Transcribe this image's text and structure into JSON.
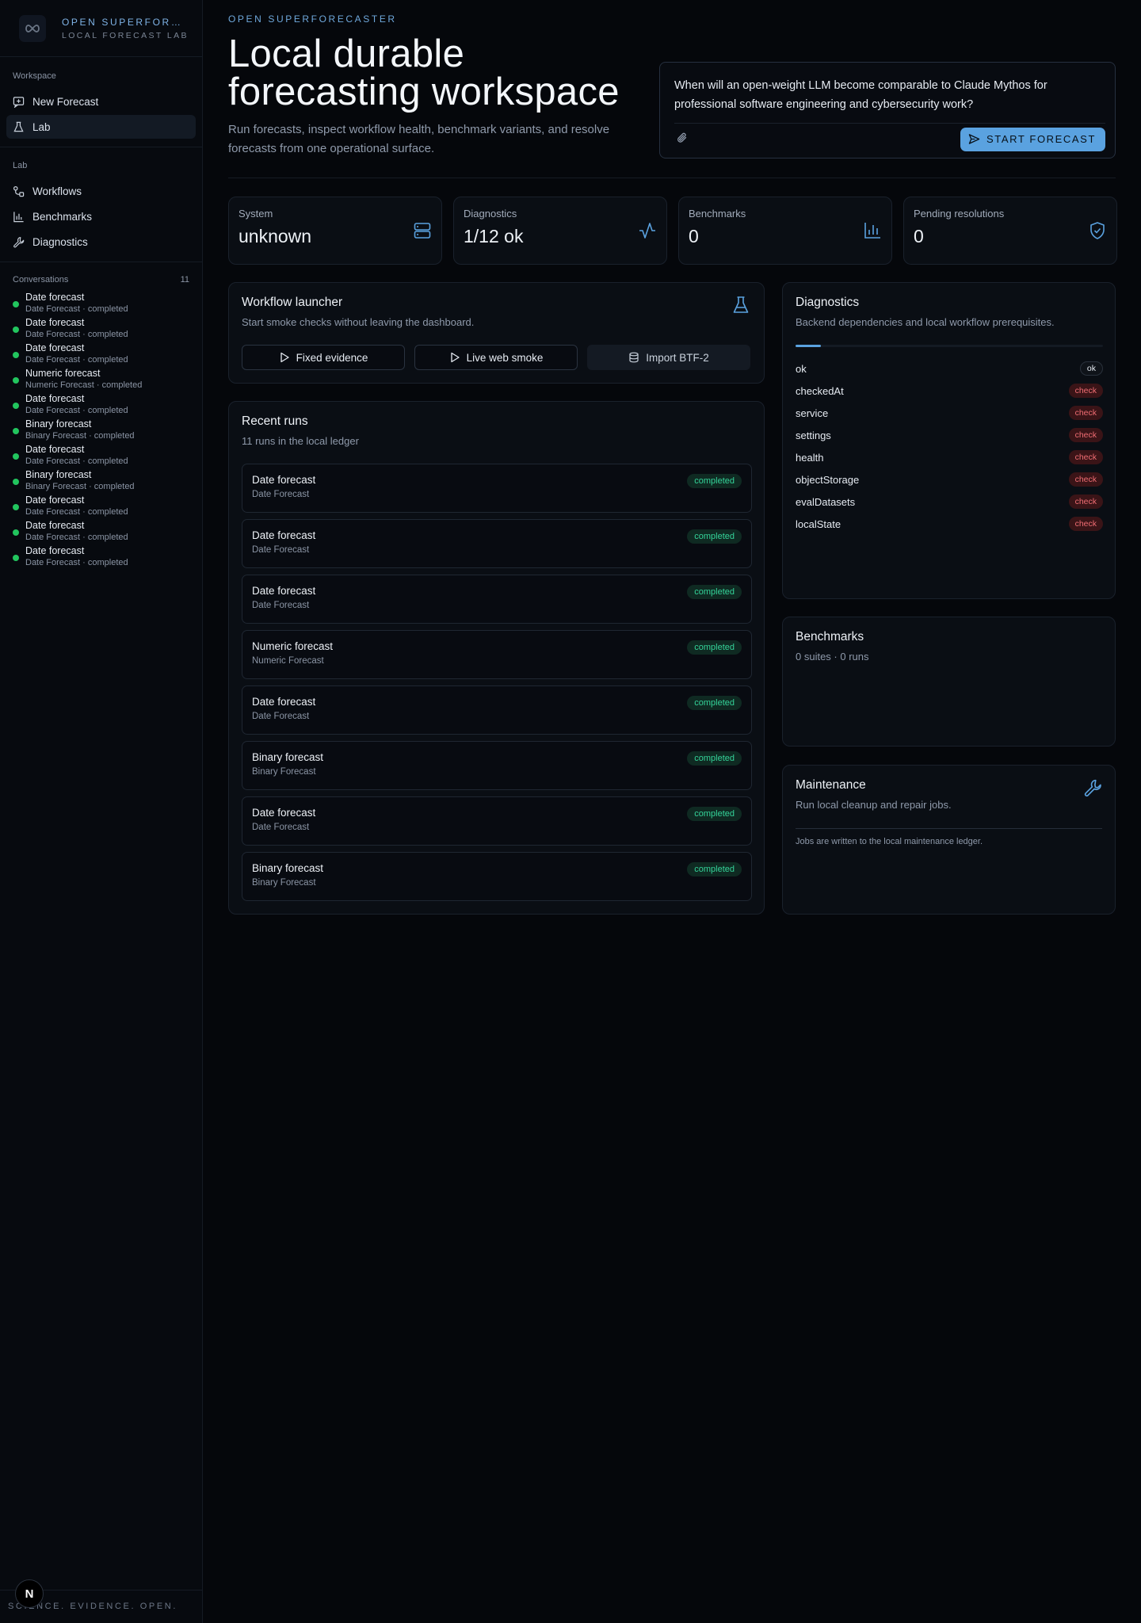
{
  "brand": {
    "title": "OPEN SUPERFORE…",
    "subtitle": "LOCAL FORECAST LAB"
  },
  "sidebar": {
    "workspace_label": "Workspace",
    "workspace_items": [
      {
        "label": "New Forecast",
        "icon": "message-plus-icon"
      },
      {
        "label": "Lab",
        "icon": "flask-icon",
        "active": true
      }
    ],
    "lab_label": "Lab",
    "lab_items": [
      {
        "label": "Workflows",
        "icon": "workflow-icon"
      },
      {
        "label": "Benchmarks",
        "icon": "bar-chart-icon"
      },
      {
        "label": "Diagnostics",
        "icon": "wrench-icon"
      }
    ],
    "conversations_label": "Conversations",
    "conversations_count": "11",
    "conversations": [
      {
        "title": "Date forecast",
        "meta": "Date Forecast · completed"
      },
      {
        "title": "Date forecast",
        "meta": "Date Forecast · completed"
      },
      {
        "title": "Date forecast",
        "meta": "Date Forecast · completed"
      },
      {
        "title": "Numeric forecast",
        "meta": "Numeric Forecast · completed"
      },
      {
        "title": "Date forecast",
        "meta": "Date Forecast · completed"
      },
      {
        "title": "Binary forecast",
        "meta": "Binary Forecast · completed"
      },
      {
        "title": "Date forecast",
        "meta": "Date Forecast · completed"
      },
      {
        "title": "Binary forecast",
        "meta": "Binary Forecast · completed"
      },
      {
        "title": "Date forecast",
        "meta": "Date Forecast · completed"
      },
      {
        "title": "Date forecast",
        "meta": "Date Forecast · completed"
      },
      {
        "title": "Date forecast",
        "meta": "Date Forecast · completed"
      }
    ],
    "footer": "SCIENCE. EVIDENCE. OPEN.",
    "badge": "N"
  },
  "header": {
    "eyebrow": "OPEN SUPERFORECASTER",
    "title": "Local durable forecasting workspace",
    "description": "Run forecasts, inspect workflow health, benchmark variants, and resolve forecasts from one operational surface."
  },
  "composer": {
    "question": "When will an open-weight LLM become comparable to Claude Mythos for professional software engineering and cybersecurity work?",
    "start_label": "START FORECAST"
  },
  "stats": [
    {
      "label": "System",
      "value": "unknown",
      "icon": "server-icon"
    },
    {
      "label": "Diagnostics",
      "value": "1/12 ok",
      "icon": "activity-icon"
    },
    {
      "label": "Benchmarks",
      "value": "0",
      "icon": "bar-chart-icon"
    },
    {
      "label": "Pending resolutions",
      "value": "0",
      "icon": "shield-check-icon"
    }
  ],
  "launcher": {
    "title": "Workflow launcher",
    "subtitle": "Start smoke checks without leaving the dashboard.",
    "buttons": [
      {
        "label": "Fixed evidence",
        "icon": "play-icon"
      },
      {
        "label": "Live web smoke",
        "icon": "play-icon"
      },
      {
        "label": "Import BTF-2",
        "icon": "database-icon"
      }
    ]
  },
  "recent_runs": {
    "title": "Recent runs",
    "subtitle": "11 runs in the local ledger",
    "runs": [
      {
        "title": "Date forecast",
        "type": "Date Forecast",
        "status": "completed"
      },
      {
        "title": "Date forecast",
        "type": "Date Forecast",
        "status": "completed"
      },
      {
        "title": "Date forecast",
        "type": "Date Forecast",
        "status": "completed"
      },
      {
        "title": "Numeric forecast",
        "type": "Numeric Forecast",
        "status": "completed"
      },
      {
        "title": "Date forecast",
        "type": "Date Forecast",
        "status": "completed"
      },
      {
        "title": "Binary forecast",
        "type": "Binary Forecast",
        "status": "completed"
      },
      {
        "title": "Date forecast",
        "type": "Date Forecast",
        "status": "completed"
      },
      {
        "title": "Binary forecast",
        "type": "Binary Forecast",
        "status": "completed"
      }
    ]
  },
  "diagnostics": {
    "title": "Diagnostics",
    "subtitle": "Backend dependencies and local workflow prerequisites.",
    "items": [
      {
        "name": "ok",
        "status": "ok"
      },
      {
        "name": "checkedAt",
        "status": "check"
      },
      {
        "name": "service",
        "status": "check"
      },
      {
        "name": "settings",
        "status": "check"
      },
      {
        "name": "health",
        "status": "check"
      },
      {
        "name": "objectStorage",
        "status": "check"
      },
      {
        "name": "evalDatasets",
        "status": "check"
      },
      {
        "name": "localState",
        "status": "check"
      }
    ]
  },
  "benchmarks": {
    "title": "Benchmarks",
    "subtitle": "0 suites · 0 runs"
  },
  "maintenance": {
    "title": "Maintenance",
    "subtitle": "Run local cleanup and repair jobs.",
    "note": "Jobs are written to the local maintenance ledger."
  },
  "colors": {
    "accent": "#5aa2e0",
    "success": "#34d399",
    "danger": "#f06d73",
    "background": "#05070b"
  }
}
